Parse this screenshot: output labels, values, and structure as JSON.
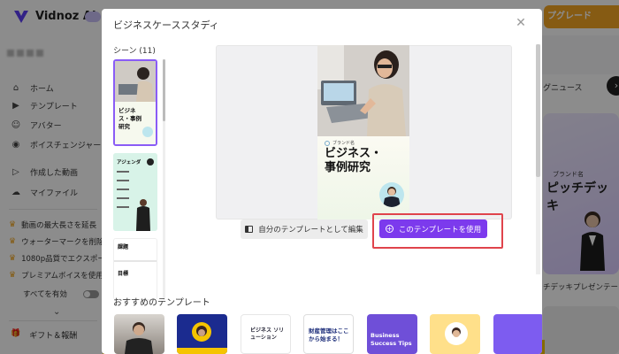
{
  "app": {
    "brand": "Vidnoz AI",
    "badge": "",
    "upgrade_label": "プグレード",
    "colors": {
      "accent": "#7c3aed",
      "upgrade": "#f5a623",
      "highlight": "#e0444c"
    }
  },
  "sidebar": {
    "items": [
      {
        "label": "ホーム",
        "icon": "home-icon"
      },
      {
        "label": "テンプレート",
        "icon": "template-icon"
      },
      {
        "label": "アバター",
        "icon": "avatar-icon"
      },
      {
        "label": "ボイスチェンジャー",
        "icon": "voice-changer-icon"
      },
      {
        "label": "作成した動画",
        "icon": "video-icon"
      },
      {
        "label": "マイファイル",
        "icon": "cloud-upload-icon"
      }
    ],
    "premium": [
      "動画の最大長さを延長",
      "ウォーターマークを削除",
      "1080p品質でエクスポート",
      "プレミアムボイスを使用"
    ],
    "toggle_label": "すべてを有効",
    "gift_label": "ギフト＆報酬"
  },
  "right": {
    "news": "グニュース",
    "pitch_brand": "ブランド名",
    "pitch_title": "ピッチデッキ",
    "pitch_caption": "チデッキプレゼンテー"
  },
  "modal": {
    "title": "ビジネスケーススタディ",
    "scene_label": "シーン (11)",
    "thumbs": [
      {
        "title": "ビジネス・事例研究"
      },
      {
        "title": "アジェンダ"
      },
      {
        "title1": "課題",
        "title2": "目標"
      }
    ],
    "slide": {
      "brand": "ブランド名",
      "title": "ビジネス・事例研究",
      "subtitle": "",
      "footer": ""
    },
    "edit_button": "自分のテンプレートとして編集",
    "use_button": "このテンプレートを使用",
    "recommended_label": "おすすめのテンプレート",
    "recommended": [
      {
        "text": ""
      },
      {
        "text": ""
      },
      {
        "text": "ビジネス ソリューション"
      },
      {
        "text": "財産管理はここから始まる！"
      },
      {
        "text": "Business Success Tips"
      },
      {
        "text": ""
      },
      {
        "text": ""
      }
    ]
  }
}
